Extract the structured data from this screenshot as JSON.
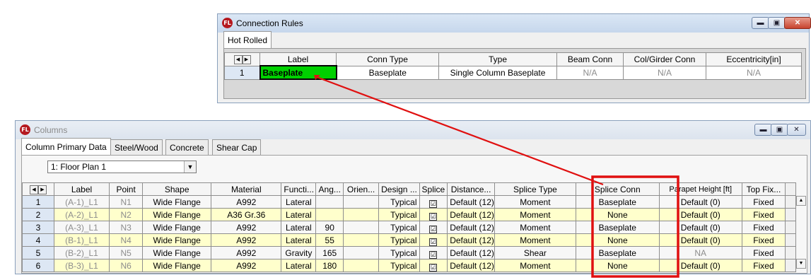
{
  "connection_rules": {
    "logo": "FL",
    "title": "Connection Rules",
    "tab": "Hot Rolled",
    "columns": [
      "Label",
      "Conn Type",
      "Type",
      "Beam Conn",
      "Col/Girder Conn",
      "Eccentricity[in]"
    ],
    "rows": [
      {
        "num": "1",
        "label": "Baseplate",
        "conn_type": "Baseplate",
        "type": "Single Column Baseplate",
        "beam_conn": "N/A",
        "col_girder_conn": "N/A",
        "eccentricity": "N/A"
      }
    ]
  },
  "columns_window": {
    "logo": "FL",
    "title": "Columns",
    "tabs": [
      "Column Primary Data",
      "Steel/Wood",
      "Concrete",
      "Shear Cap"
    ],
    "floor_plan": "1: Floor Plan 1",
    "headers": [
      "Label",
      "Point",
      "Shape",
      "Material",
      "Functi...",
      "Ang...",
      "Orien...",
      "Design ...",
      "Splice",
      "Distance...",
      "Splice Type",
      "Splice Conn",
      "Parapet Height [ft]",
      "Top Fix..."
    ],
    "rows": [
      {
        "num": "1",
        "label": "(A-1)_L1",
        "point": "N1",
        "shape": "Wide Flange",
        "material": "A992",
        "function": "Lateral",
        "angle": "",
        "orient": "",
        "design": "Typical",
        "splice": "☑",
        "distance": "Default (12)",
        "splice_type": "Moment",
        "splice_conn": "Baseplate",
        "parapet": "Default (0)",
        "top_fix": "Fixed"
      },
      {
        "num": "2",
        "label": "(A-2)_L1",
        "point": "N2",
        "shape": "Wide Flange",
        "material": "A36 Gr.36",
        "function": "Lateral",
        "angle": "",
        "orient": "",
        "design": "Typical",
        "splice": "☑",
        "distance": "Default (12)",
        "splice_type": "Moment",
        "splice_conn": "None",
        "parapet": "Default (0)",
        "top_fix": "Fixed"
      },
      {
        "num": "3",
        "label": "(A-3)_L1",
        "point": "N3",
        "shape": "Wide Flange",
        "material": "A992",
        "function": "Lateral",
        "angle": "90",
        "orient": "",
        "design": "Typical",
        "splice": "☑",
        "distance": "Default (12)",
        "splice_type": "Moment",
        "splice_conn": "Baseplate",
        "parapet": "Default (0)",
        "top_fix": "Fixed"
      },
      {
        "num": "4",
        "label": "(B-1)_L1",
        "point": "N4",
        "shape": "Wide Flange",
        "material": "A992",
        "function": "Lateral",
        "angle": "55",
        "orient": "",
        "design": "Typical",
        "splice": "☑",
        "distance": "Default (12)",
        "splice_type": "Moment",
        "splice_conn": "None",
        "parapet": "Default (0)",
        "top_fix": "Fixed"
      },
      {
        "num": "5",
        "label": "(B-2)_L1",
        "point": "N5",
        "shape": "Wide Flange",
        "material": "A992",
        "function": "Gravity",
        "angle": "165",
        "orient": "",
        "design": "Typical",
        "splice": "☑",
        "distance": "Default (12)",
        "splice_type": "Shear",
        "splice_conn": "Baseplate",
        "parapet": "NA",
        "top_fix": "Fixed"
      },
      {
        "num": "6",
        "label": "(B-3)_L1",
        "point": "N6",
        "shape": "Wide Flange",
        "material": "A992",
        "function": "Lateral",
        "angle": "180",
        "orient": "",
        "design": "Typical",
        "splice": "☑",
        "distance": "Default (12)",
        "splice_type": "Moment",
        "splice_conn": "None",
        "parapet": "Default (0)",
        "top_fix": "Fixed"
      }
    ]
  },
  "colors": {
    "highlight_green": "#00d000",
    "annotation_red": "#e01010",
    "row_yellow": "#ffffcc"
  }
}
